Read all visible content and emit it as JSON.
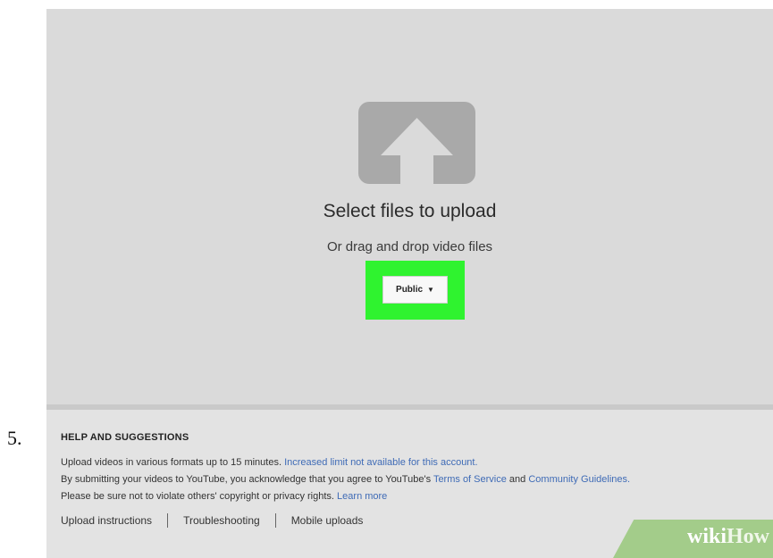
{
  "step": {
    "number": "5."
  },
  "upload": {
    "title": "Select files to upload",
    "subtitle": "Or drag and drop video files",
    "privacy_value": "Public",
    "icon": "upload-arrow-icon"
  },
  "help": {
    "heading": "HELP AND SUGGESTIONS",
    "line1_text": "Upload videos in various formats up to 15 minutes.",
    "line1_link": "Increased limit not available for this account.",
    "line2_text_a": "By submitting your videos to YouTube, you acknowledge that you agree to YouTube's",
    "line2_link_a": "Terms of Service",
    "line2_text_b": "and",
    "line2_link_b": "Community Guidelines.",
    "line3_text": "Please be sure not to violate others' copyright or privacy rights.",
    "line3_link": "Learn more",
    "links": [
      "Upload instructions",
      "Troubleshooting",
      "Mobile uploads"
    ]
  },
  "watermark": {
    "part1": "wiki",
    "part2": "How"
  },
  "colors": {
    "highlight": "#2ff32f",
    "link": "#3f6bb6",
    "icon": "#a9a9a9"
  }
}
